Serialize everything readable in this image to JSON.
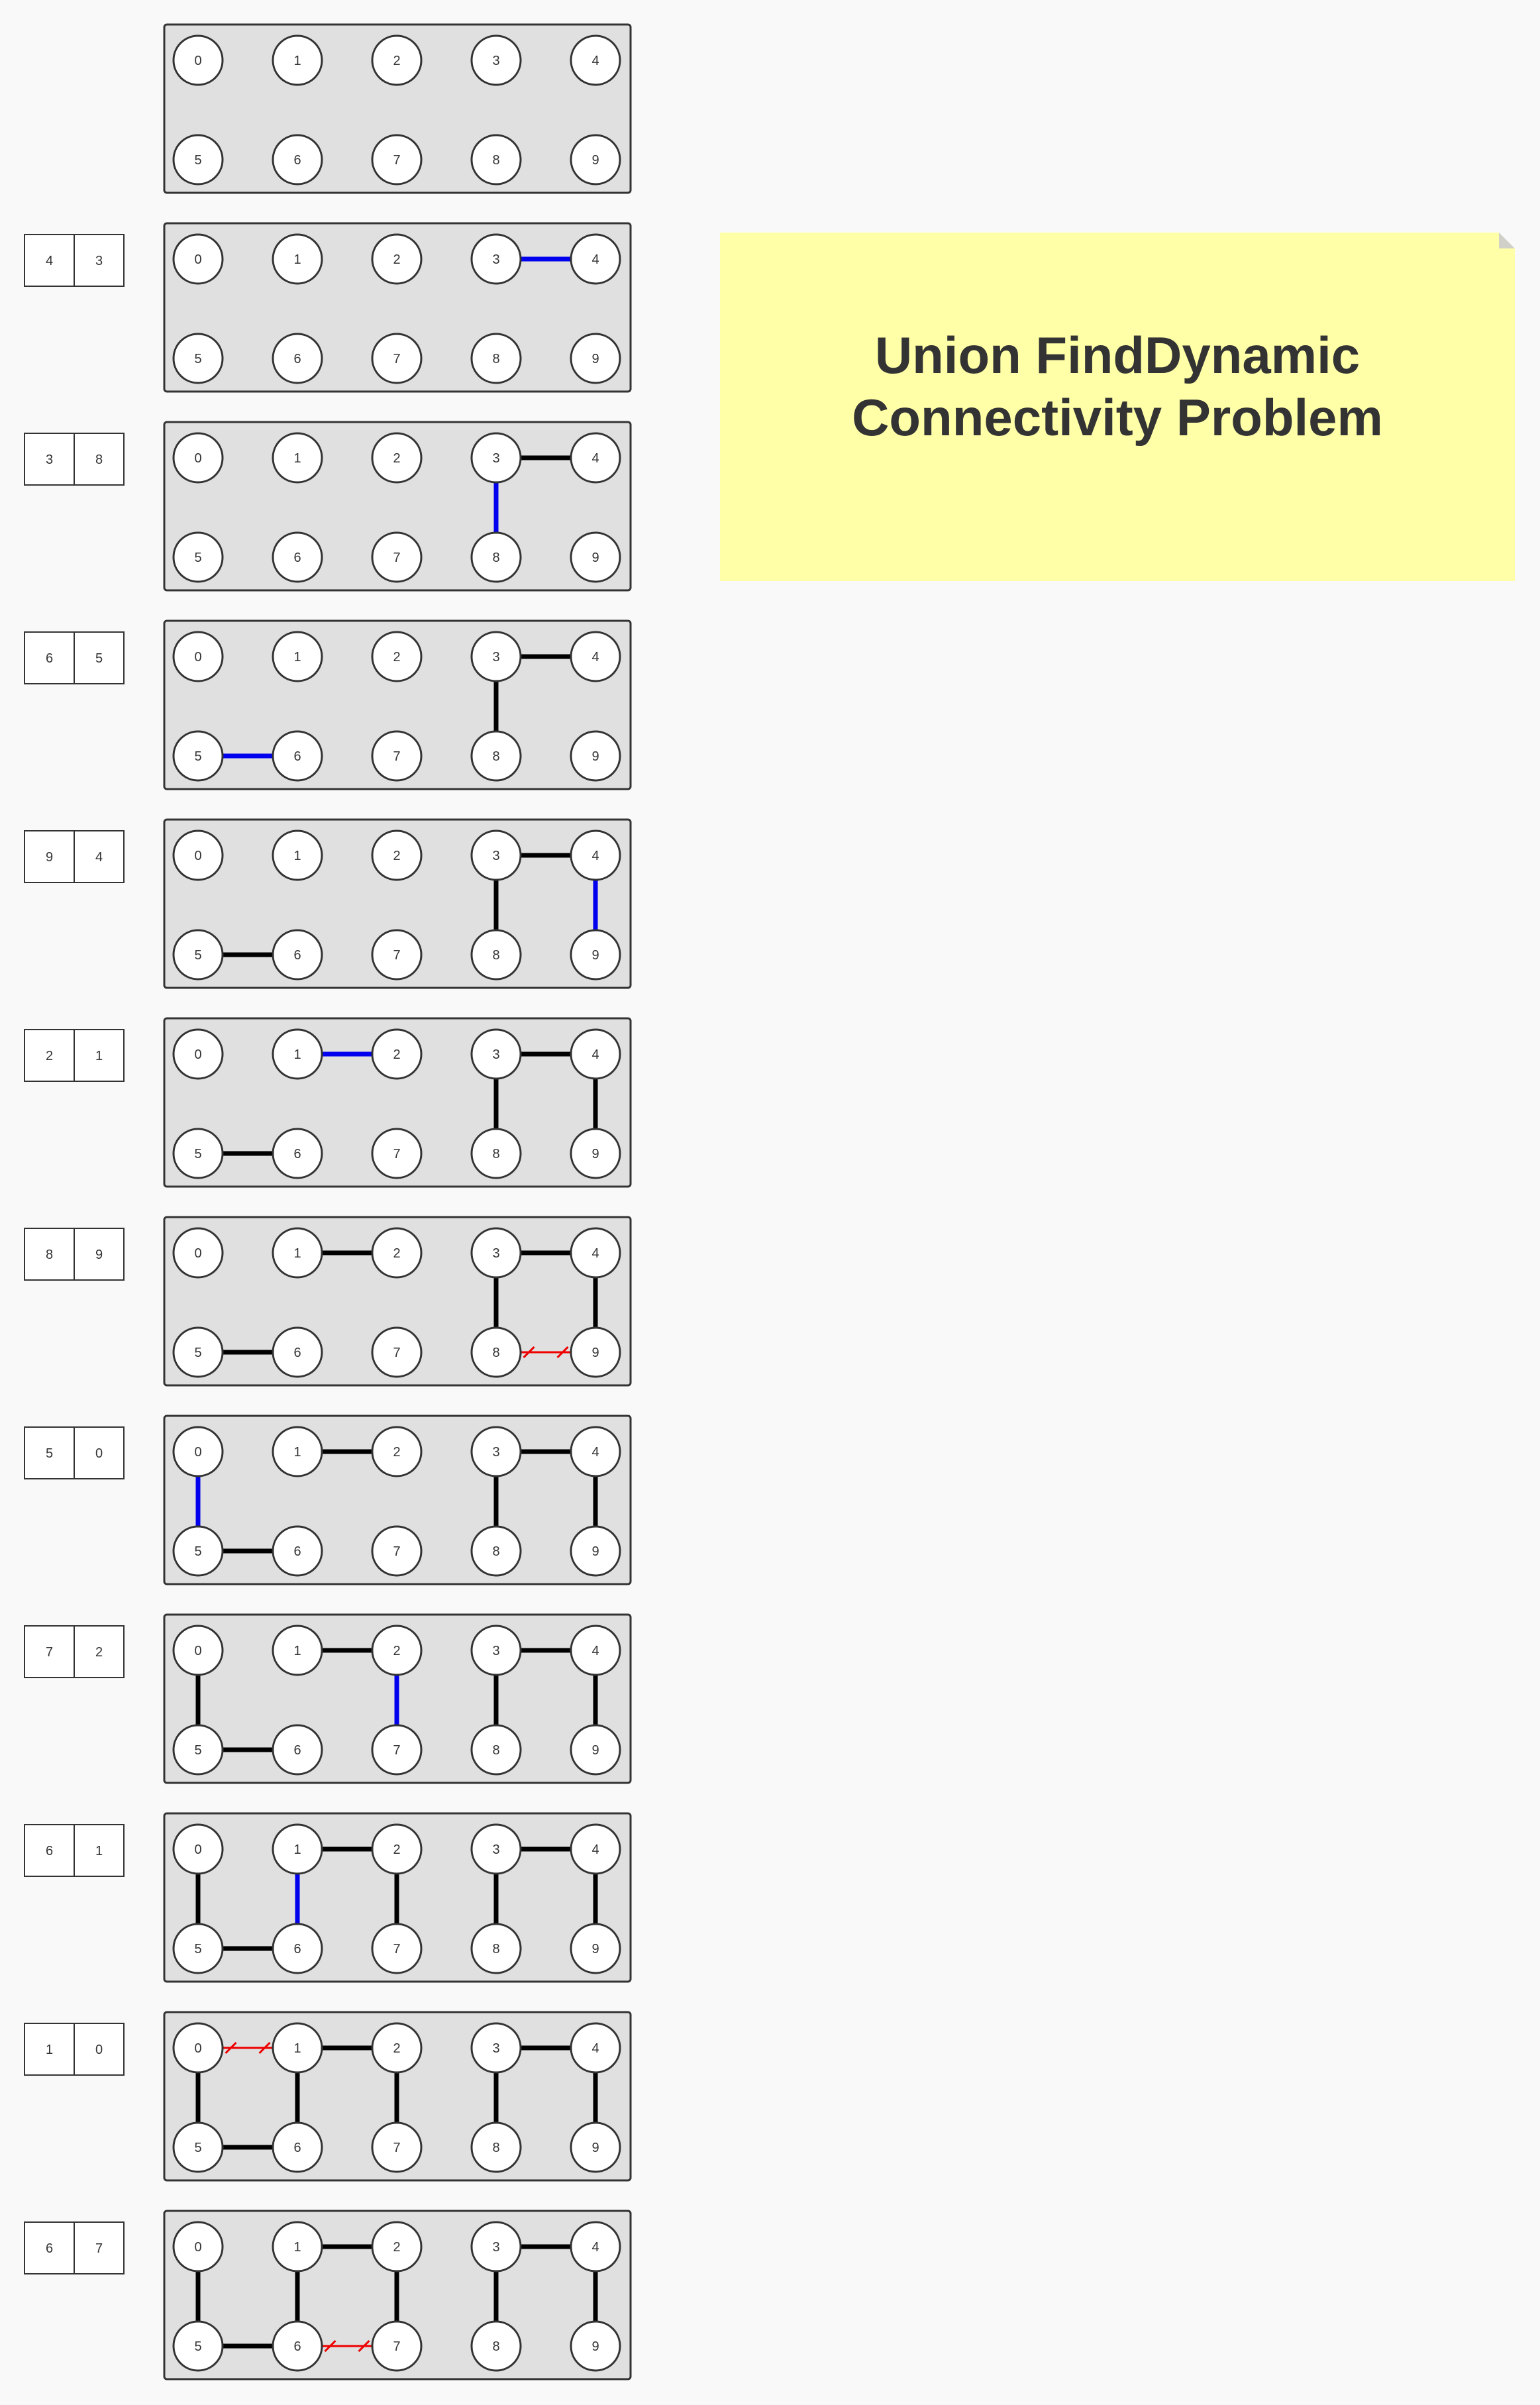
{
  "note": {
    "title": "Union FindDynamic Connectivity Problem"
  },
  "nodes": [
    "0",
    "1",
    "2",
    "3",
    "4",
    "5",
    "6",
    "7",
    "8",
    "9"
  ],
  "colors": {
    "panel_fill": "#e0e0e0",
    "panel_stroke": "#333333",
    "node_fill": "#ffffff",
    "edge": "#000000",
    "new_edge": "#0000ee",
    "redundant_edge": "#ee0000",
    "note_fill": "#ffffa8",
    "text": "#333333"
  },
  "steps": [
    {
      "pair": null,
      "edges": [],
      "new_edge": null,
      "redundant_edge": null
    },
    {
      "pair": [
        "4",
        "3"
      ],
      "edges": [],
      "new_edge": [
        "3",
        "4"
      ],
      "redundant_edge": null
    },
    {
      "pair": [
        "3",
        "8"
      ],
      "edges": [
        [
          "3",
          "4"
        ]
      ],
      "new_edge": [
        "3",
        "8"
      ],
      "redundant_edge": null
    },
    {
      "pair": [
        "6",
        "5"
      ],
      "edges": [
        [
          "3",
          "4"
        ],
        [
          "3",
          "8"
        ]
      ],
      "new_edge": [
        "5",
        "6"
      ],
      "redundant_edge": null
    },
    {
      "pair": [
        "9",
        "4"
      ],
      "edges": [
        [
          "3",
          "4"
        ],
        [
          "3",
          "8"
        ],
        [
          "5",
          "6"
        ]
      ],
      "new_edge": [
        "4",
        "9"
      ],
      "redundant_edge": null
    },
    {
      "pair": [
        "2",
        "1"
      ],
      "edges": [
        [
          "3",
          "4"
        ],
        [
          "3",
          "8"
        ],
        [
          "5",
          "6"
        ],
        [
          "4",
          "9"
        ]
      ],
      "new_edge": [
        "1",
        "2"
      ],
      "redundant_edge": null
    },
    {
      "pair": [
        "8",
        "9"
      ],
      "edges": [
        [
          "3",
          "4"
        ],
        [
          "3",
          "8"
        ],
        [
          "5",
          "6"
        ],
        [
          "4",
          "9"
        ],
        [
          "1",
          "2"
        ]
      ],
      "new_edge": null,
      "redundant_edge": [
        "8",
        "9"
      ]
    },
    {
      "pair": [
        "5",
        "0"
      ],
      "edges": [
        [
          "3",
          "4"
        ],
        [
          "3",
          "8"
        ],
        [
          "5",
          "6"
        ],
        [
          "4",
          "9"
        ],
        [
          "1",
          "2"
        ]
      ],
      "new_edge": [
        "0",
        "5"
      ],
      "redundant_edge": null
    },
    {
      "pair": [
        "7",
        "2"
      ],
      "edges": [
        [
          "3",
          "4"
        ],
        [
          "3",
          "8"
        ],
        [
          "5",
          "6"
        ],
        [
          "4",
          "9"
        ],
        [
          "1",
          "2"
        ],
        [
          "0",
          "5"
        ]
      ],
      "new_edge": [
        "2",
        "7"
      ],
      "redundant_edge": null
    },
    {
      "pair": [
        "6",
        "1"
      ],
      "edges": [
        [
          "3",
          "4"
        ],
        [
          "3",
          "8"
        ],
        [
          "5",
          "6"
        ],
        [
          "4",
          "9"
        ],
        [
          "1",
          "2"
        ],
        [
          "0",
          "5"
        ],
        [
          "2",
          "7"
        ]
      ],
      "new_edge": [
        "1",
        "6"
      ],
      "redundant_edge": null
    },
    {
      "pair": [
        "1",
        "0"
      ],
      "edges": [
        [
          "3",
          "4"
        ],
        [
          "3",
          "8"
        ],
        [
          "5",
          "6"
        ],
        [
          "4",
          "9"
        ],
        [
          "1",
          "2"
        ],
        [
          "0",
          "5"
        ],
        [
          "2",
          "7"
        ],
        [
          "1",
          "6"
        ]
      ],
      "new_edge": null,
      "redundant_edge": [
        "0",
        "1"
      ]
    },
    {
      "pair": [
        "6",
        "7"
      ],
      "edges": [
        [
          "3",
          "4"
        ],
        [
          "3",
          "8"
        ],
        [
          "5",
          "6"
        ],
        [
          "4",
          "9"
        ],
        [
          "1",
          "2"
        ],
        [
          "0",
          "5"
        ],
        [
          "2",
          "7"
        ],
        [
          "1",
          "6"
        ]
      ],
      "new_edge": null,
      "redundant_edge": [
        "6",
        "7"
      ]
    }
  ]
}
